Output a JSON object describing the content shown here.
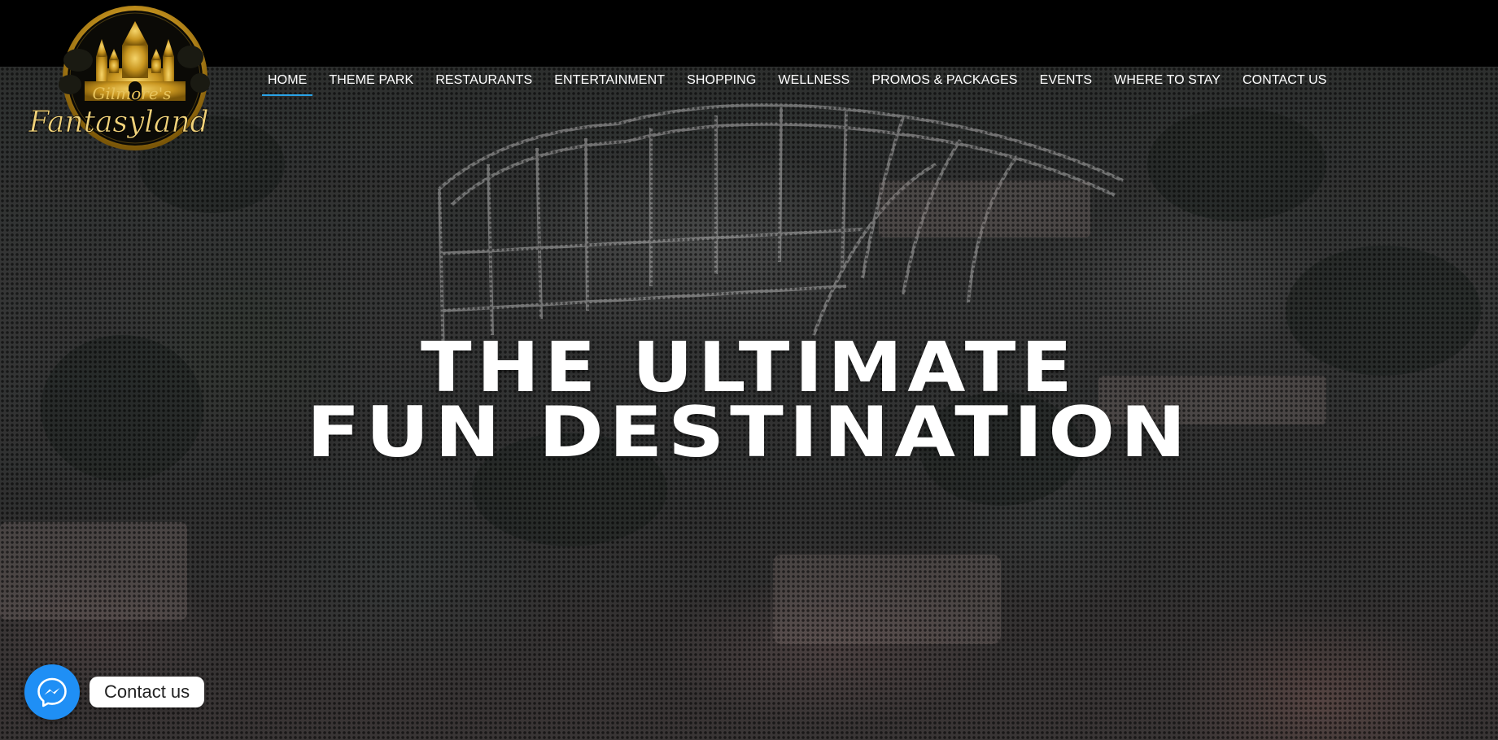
{
  "brand": {
    "logo_icon": "fantasyland-castle-logo",
    "logo_text_top": "Gilmore's",
    "logo_text_main": "Fantasyland",
    "gold": "#d4a52a"
  },
  "nav": {
    "items": [
      {
        "label": "HOME",
        "active": true
      },
      {
        "label": "THEME PARK",
        "active": false
      },
      {
        "label": "RESTAURANTS",
        "active": false
      },
      {
        "label": "ENTERTAINMENT",
        "active": false
      },
      {
        "label": "SHOPPING",
        "active": false
      },
      {
        "label": "WELLNESS",
        "active": false
      },
      {
        "label": "PROMOS & PACKAGES",
        "active": false
      },
      {
        "label": "EVENTS",
        "active": false
      },
      {
        "label": "WHERE TO STAY",
        "active": false
      },
      {
        "label": "CONTACT US",
        "active": false
      }
    ],
    "active_underline_color": "#2aa3e6"
  },
  "hero": {
    "line1": "THE ULTIMATE",
    "line2": "FUN DESTINATION"
  },
  "contact_widget": {
    "icon": "messenger-icon",
    "label": "Contact us",
    "button_color": "#1f8ff5"
  }
}
